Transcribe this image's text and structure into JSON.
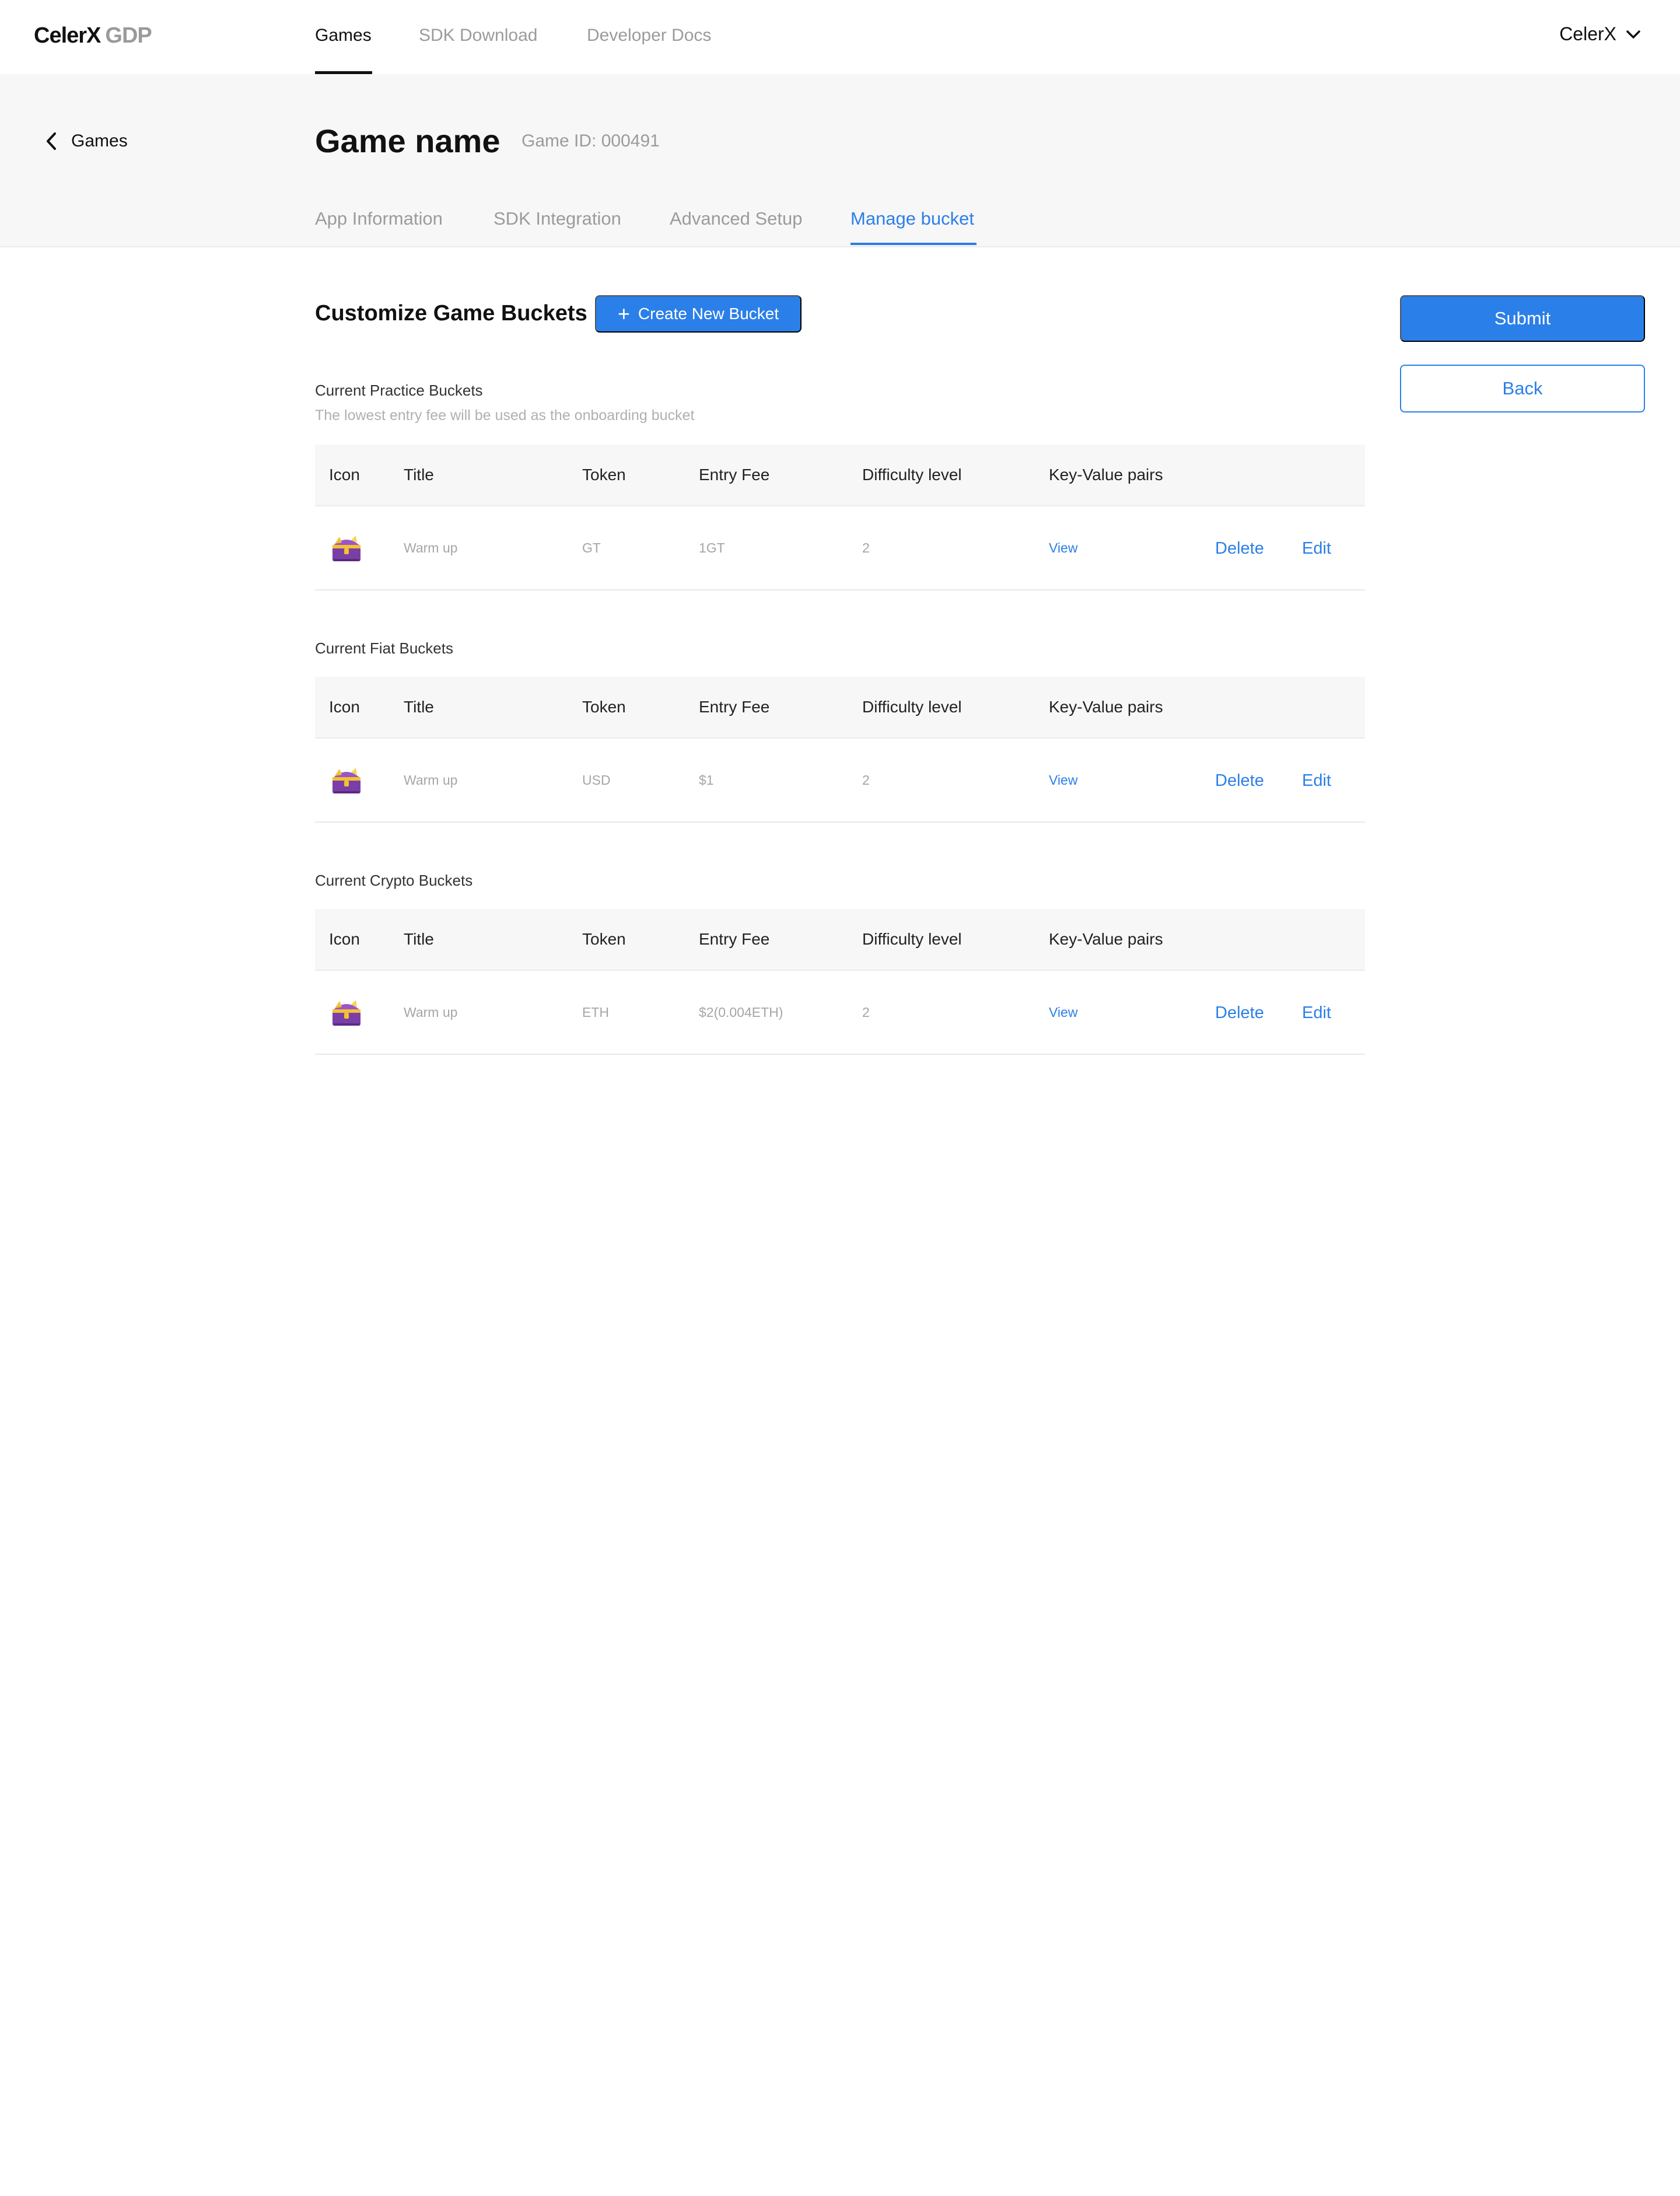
{
  "brand": {
    "name": "CelerX",
    "suffix": "GDP"
  },
  "topnav": {
    "links": [
      {
        "label": "Games",
        "active": true
      },
      {
        "label": "SDK Download",
        "active": false
      },
      {
        "label": "Developer Docs",
        "active": false
      }
    ],
    "account_label": "CelerX"
  },
  "header": {
    "back_label": "Games",
    "game_title": "Game name",
    "game_id": "Game ID: 000491",
    "tabs": [
      {
        "label": "App Information",
        "active": false
      },
      {
        "label": "SDK Integration",
        "active": false
      },
      {
        "label": "Advanced Setup",
        "active": false
      },
      {
        "label": "Manage bucket",
        "active": true
      }
    ]
  },
  "content": {
    "section_title": "Customize Game Buckets",
    "create_button": "Create New Bucket",
    "submit_button": "Submit",
    "back_button": "Back",
    "columns": [
      "Icon",
      "Title",
      "Token",
      "Entry Fee",
      "Difficulty level",
      "Key-Value pairs"
    ],
    "groups": [
      {
        "label": "Current Practice Buckets",
        "note": "The lowest entry fee will be used as the onboarding bucket",
        "rows": [
          {
            "icon": "treasure-chest-icon",
            "title": "Warm up",
            "token": "GT",
            "entry_fee": "1GT",
            "difficulty": "2",
            "kv": "View",
            "delete": "Delete",
            "edit": "Edit"
          }
        ]
      },
      {
        "label": "Current Fiat Buckets",
        "rows": [
          {
            "icon": "treasure-chest-icon",
            "title": "Warm up",
            "token": "USD",
            "entry_fee": "$1",
            "difficulty": "2",
            "kv": "View",
            "delete": "Delete",
            "edit": "Edit"
          }
        ]
      },
      {
        "label": "Current Crypto Buckets",
        "rows": [
          {
            "icon": "treasure-chest-icon",
            "title": "Warm up",
            "token": "ETH",
            "entry_fee": "$2(0.004ETH)",
            "difficulty": "2",
            "kv": "View",
            "delete": "Delete",
            "edit": "Edit"
          }
        ]
      }
    ]
  },
  "colors": {
    "accent": "#2b7fe8",
    "text": "#111111",
    "muted": "#9b9b9b",
    "band": "#f7f7f7"
  }
}
